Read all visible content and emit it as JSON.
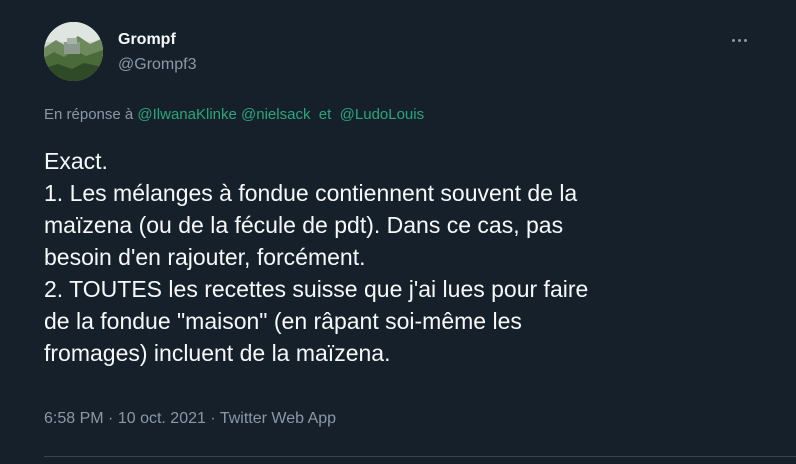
{
  "author": {
    "display_name": "Grompf",
    "handle": "@Grompf3"
  },
  "reply": {
    "prefix": "En réponse à",
    "mention_1": "@IlwanaKlinke",
    "mention_2": "@nielsack",
    "separator": "et",
    "mention_3": "@LudoLouis"
  },
  "body": {
    "lines": [
      "Exact.",
      "1. Les mélanges à fondue contiennent souvent de la",
      "maïzena (ou de la fécule de pdt). Dans ce cas, pas",
      "besoin d'en rajouter, forcément.",
      "2. TOUTES les recettes suisse que j'ai lues pour faire",
      "de la fondue \"maison\" (en râpant soi-même les",
      "fromages) incluent de la maïzena."
    ]
  },
  "meta": {
    "time": "6:58 PM",
    "dot_1": "·",
    "date": "10 oct. 2021",
    "dot_2": "·",
    "source": "Twitter Web App"
  },
  "icons": {
    "more": "more-horizontal-icon"
  },
  "colors": {
    "background": "#15202b",
    "text": "#f7f9f9",
    "secondary": "#8b98a5",
    "mention": "#1d9bf0"
  }
}
